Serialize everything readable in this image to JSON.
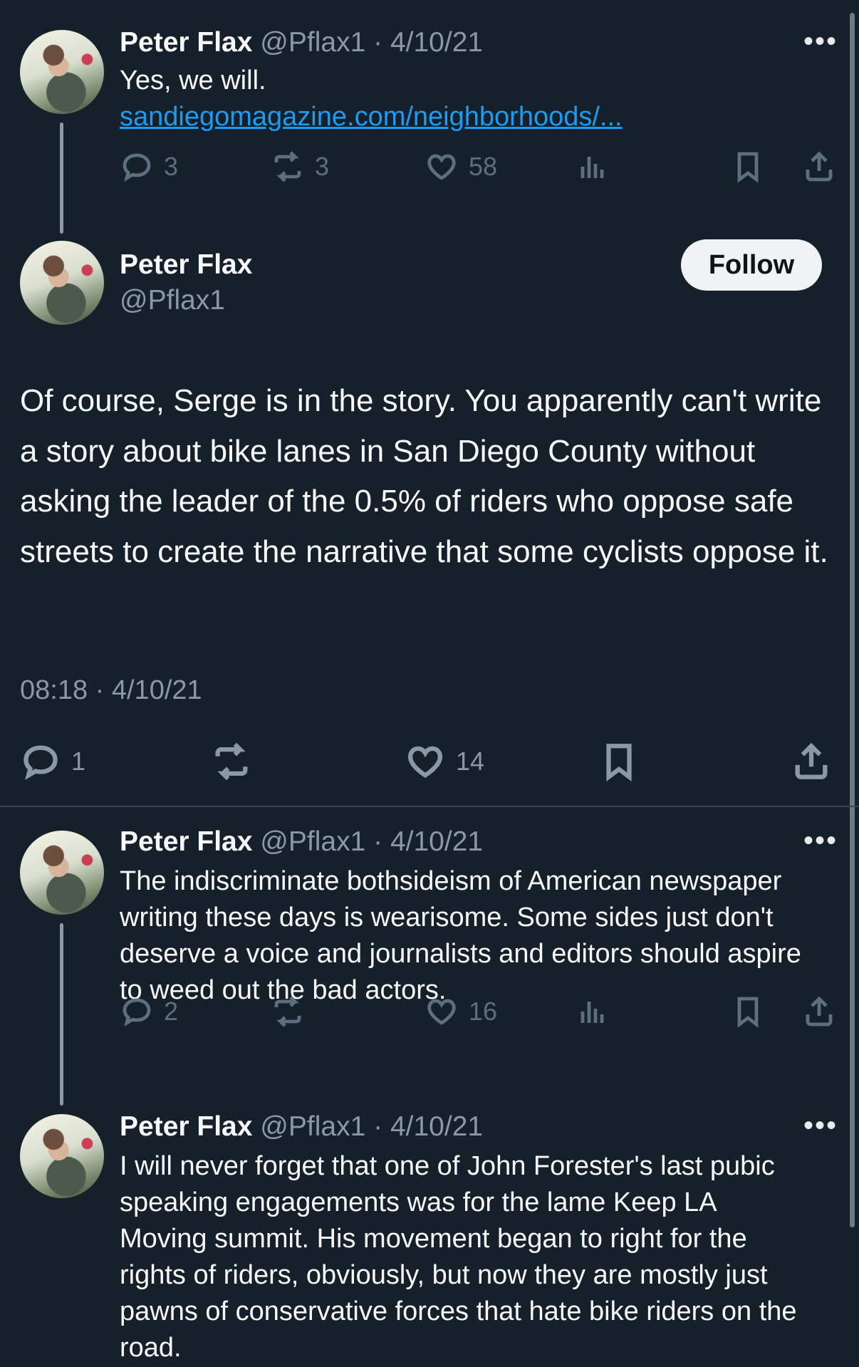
{
  "tweets": [
    {
      "name": "Peter Flax",
      "handle": "@Pflax1",
      "sep": "·",
      "date": "4/10/21",
      "text": "Yes, we will.",
      "link": "sandiegomagazine.com/neighborhoods/...",
      "replies": "3",
      "retweets": "3",
      "likes": "58"
    },
    {
      "name": "Peter Flax",
      "handle": "@Pflax1",
      "sep": "·",
      "date": "4/10/21",
      "text": "The indiscriminate bothsideism of American newspaper writing these days is wearisome. Some sides just don't deserve a voice and journalists and editors should aspire to weed out the bad actors.",
      "replies": "2",
      "retweets": "",
      "likes": "16"
    },
    {
      "name": "Peter Flax",
      "handle": "@Pflax1",
      "sep": "·",
      "date": "4/10/21",
      "text": "I will never forget that one of John Forester's last pubic speaking engagements was for the lame Keep LA Moving summit. His movement began to right for the rights of riders, obviously, but now they are mostly just pawns of conservative forces that hate bike riders on the road."
    }
  ],
  "main": {
    "name": "Peter Flax",
    "handle": "@Pflax1",
    "follow_label": "Follow",
    "text": "Of course, Serge is in the story. You apparently can't write a story about bike lanes in San Diego County without asking the leader of the 0.5% of riders who oppose safe streets to create the narrative that some cyclists oppose it.",
    "timestamp": "08:18 · 4/10/21",
    "replies": "1",
    "likes": "14"
  },
  "icons": [
    "more-icon",
    "reply-icon",
    "retweet-icon",
    "like-icon",
    "views-icon",
    "bookmark-icon",
    "share-icon"
  ]
}
